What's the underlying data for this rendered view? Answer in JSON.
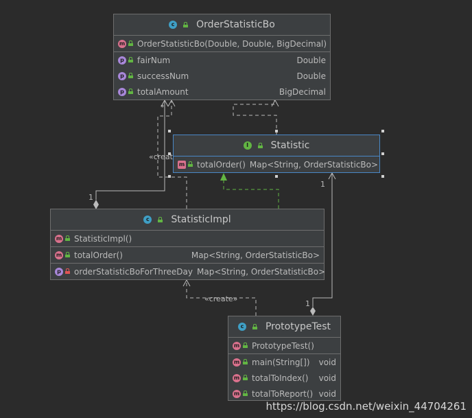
{
  "classes": {
    "order_statistic_bo": {
      "name": "OrderStatisticBo",
      "kind_icon": "class-icon",
      "constructors": [
        {
          "name": "OrderStatisticBo(Double, Double, BigDecimal)"
        }
      ],
      "fields": [
        {
          "name": "fairNum",
          "type": "Double"
        },
        {
          "name": "successNum",
          "type": "Double"
        },
        {
          "name": "totalAmount",
          "type": "BigDecimal"
        }
      ]
    },
    "statistic": {
      "name": "Statistic",
      "kind_icon": "interface-icon",
      "methods": [
        {
          "name": "totalOrder()",
          "type": "Map<String, OrderStatisticBo>"
        }
      ]
    },
    "statistic_impl": {
      "name": "StatisticImpl",
      "kind_icon": "class-icon",
      "constructors": [
        {
          "name": "StatisticImpl()"
        }
      ],
      "methods": [
        {
          "name": "totalOrder()",
          "type": "Map<String, OrderStatisticBo>"
        }
      ],
      "fields": [
        {
          "name": "orderStatisticBoForThreeDay",
          "type": "Map<String, OrderStatisticBo>"
        }
      ]
    },
    "prototype_test": {
      "name": "PrototypeTest",
      "kind_icon": "class-icon",
      "constructors": [
        {
          "name": "PrototypeTest()"
        }
      ],
      "methods": [
        {
          "name": "main(String[])",
          "type": "void"
        },
        {
          "name": "totalToIndex()",
          "type": "void"
        },
        {
          "name": "totalToReport()",
          "type": "void"
        }
      ]
    }
  },
  "icon_letters": {
    "class": "c",
    "interface": "I",
    "method": "m",
    "property": "p"
  },
  "edge_labels": {
    "create_left": "«creat",
    "create_bottom": "«create»",
    "multiplicity_star": "*",
    "multiplicity_one_left": "1",
    "multiplicity_one_right": "1",
    "multiplicity_one_bottom": "1"
  },
  "watermark": "https://blog.csdn.net/weixin_44704261",
  "colors": {
    "background": "#2b2b2b",
    "box": "#3c3f41",
    "selected_border": "#4a88c7",
    "implements_arrow": "#62b543",
    "edge": "#bbbbbb"
  }
}
